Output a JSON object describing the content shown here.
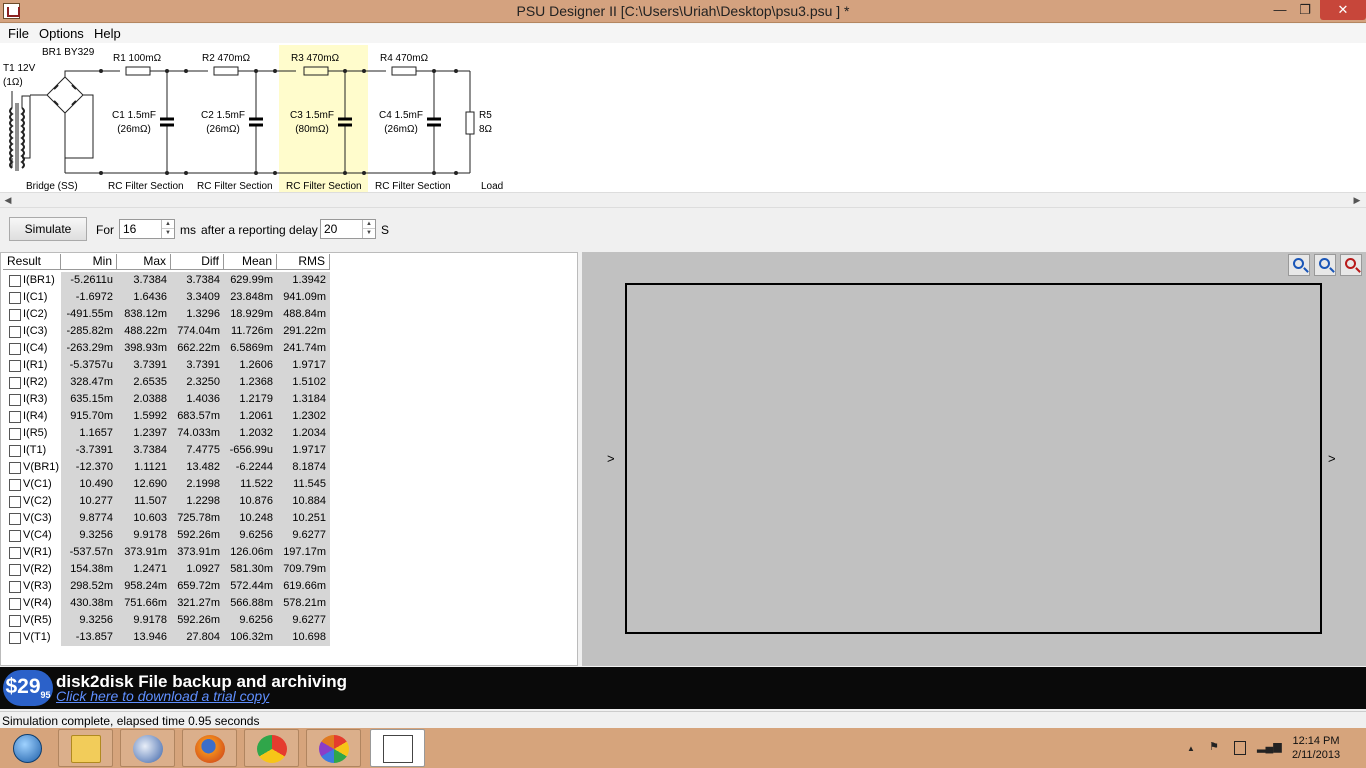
{
  "window": {
    "title": "PSU Designer II  [C:\\Users\\Uriah\\Desktop\\psu3.psu ] *",
    "min_glyph": "—",
    "max_glyph": "❐",
    "close_glyph": "✕"
  },
  "menu": {
    "file": "File",
    "options": "Options",
    "help": "Help"
  },
  "schematic": {
    "t1_name": "T1 12V",
    "t1_res": "(1Ω)",
    "br1": "BR1 BY329",
    "r1": "R1 100mΩ",
    "r2": "R2 470mΩ",
    "r3": "R3 470mΩ",
    "r4": "R4 470mΩ",
    "c1_val": "C1 1.5mF",
    "c1_esr": "(26mΩ)",
    "c2_val": "C2 1.5mF",
    "c2_esr": "(26mΩ)",
    "c3_val": "C3 1.5mF",
    "c3_esr": "(80mΩ)",
    "c4_val": "C4 1.5mF",
    "c4_esr": "(26mΩ)",
    "r5_name": "R5",
    "r5_val": "8Ω",
    "bridge_label": "Bridge (SS)",
    "section1": "RC Filter Section",
    "section2": "RC Filter Section",
    "section3": "RC Filter Section",
    "section4": "RC Filter Section",
    "load_label": "Load"
  },
  "toolbar": {
    "simulate": "Simulate",
    "for_label": "For",
    "duration": "16",
    "ms_label": "ms",
    "delay_label": "after a reporting delay of",
    "delay": "20",
    "s_label": "S"
  },
  "results": {
    "headers": [
      "Result",
      "Min",
      "Max",
      "Diff",
      "Mean",
      "RMS"
    ],
    "rows": [
      {
        "name": "I(BR1)",
        "min": "-5.2611u",
        "max": "3.7384",
        "diff": "3.7384",
        "mean": "629.99m",
        "rms": "1.3942"
      },
      {
        "name": "I(C1)",
        "min": "-1.6972",
        "max": "1.6436",
        "diff": "3.3409",
        "mean": "23.848m",
        "rms": "941.09m"
      },
      {
        "name": "I(C2)",
        "min": "-491.55m",
        "max": "838.12m",
        "diff": "1.3296",
        "mean": "18.929m",
        "rms": "488.84m"
      },
      {
        "name": "I(C3)",
        "min": "-285.82m",
        "max": "488.22m",
        "diff": "774.04m",
        "mean": "11.726m",
        "rms": "291.22m"
      },
      {
        "name": "I(C4)",
        "min": "-263.29m",
        "max": "398.93m",
        "diff": "662.22m",
        "mean": "6.5869m",
        "rms": "241.74m"
      },
      {
        "name": "I(R1)",
        "min": "-5.3757u",
        "max": "3.7391",
        "diff": "3.7391",
        "mean": "1.2606",
        "rms": "1.9717"
      },
      {
        "name": "I(R2)",
        "min": "328.47m",
        "max": "2.6535",
        "diff": "2.3250",
        "mean": "1.2368",
        "rms": "1.5102"
      },
      {
        "name": "I(R3)",
        "min": "635.15m",
        "max": "2.0388",
        "diff": "1.4036",
        "mean": "1.2179",
        "rms": "1.3184"
      },
      {
        "name": "I(R4)",
        "min": "915.70m",
        "max": "1.5992",
        "diff": "683.57m",
        "mean": "1.2061",
        "rms": "1.2302"
      },
      {
        "name": "I(R5)",
        "min": "1.1657",
        "max": "1.2397",
        "diff": "74.033m",
        "mean": "1.2032",
        "rms": "1.2034"
      },
      {
        "name": "I(T1)",
        "min": "-3.7391",
        "max": "3.7384",
        "diff": "7.4775",
        "mean": "-656.99u",
        "rms": "1.9717"
      },
      {
        "name": "V(BR1)",
        "min": "-12.370",
        "max": "1.1121",
        "diff": "13.482",
        "mean": "-6.2244",
        "rms": "8.1874"
      },
      {
        "name": "V(C1)",
        "min": "10.490",
        "max": "12.690",
        "diff": "2.1998",
        "mean": "11.522",
        "rms": "11.545"
      },
      {
        "name": "V(C2)",
        "min": "10.277",
        "max": "11.507",
        "diff": "1.2298",
        "mean": "10.876",
        "rms": "10.884"
      },
      {
        "name": "V(C3)",
        "min": "9.8774",
        "max": "10.603",
        "diff": "725.78m",
        "mean": "10.248",
        "rms": "10.251"
      },
      {
        "name": "V(C4)",
        "min": "9.3256",
        "max": "9.9178",
        "diff": "592.26m",
        "mean": "9.6256",
        "rms": "9.6277"
      },
      {
        "name": "V(R1)",
        "min": "-537.57n",
        "max": "373.91m",
        "diff": "373.91m",
        "mean": "126.06m",
        "rms": "197.17m"
      },
      {
        "name": "V(R2)",
        "min": "154.38m",
        "max": "1.2471",
        "diff": "1.0927",
        "mean": "581.30m",
        "rms": "709.79m"
      },
      {
        "name": "V(R3)",
        "min": "298.52m",
        "max": "958.24m",
        "diff": "659.72m",
        "mean": "572.44m",
        "rms": "619.66m"
      },
      {
        "name": "V(R4)",
        "min": "430.38m",
        "max": "751.66m",
        "diff": "321.27m",
        "mean": "566.88m",
        "rms": "578.21m"
      },
      {
        "name": "V(R5)",
        "min": "9.3256",
        "max": "9.9178",
        "diff": "592.26m",
        "mean": "9.6256",
        "rms": "9.6277"
      },
      {
        "name": "V(T1)",
        "min": "-13.857",
        "max": "13.946",
        "diff": "27.804",
        "mean": "106.32m",
        "rms": "10.698"
      }
    ]
  },
  "graph": {
    "left_arrow": ">",
    "right_arrow": ">"
  },
  "ad": {
    "price": "$29",
    "price_cents": "95",
    "headline": "disk2disk File backup and archiving",
    "link": "Click here to download a trial copy"
  },
  "status": "Simulation complete, elapsed time 0.95 seconds",
  "taskbar": {
    "time": "12:14 PM",
    "date": "2/11/2013",
    "tray_chevron": "▲"
  },
  "colors": {
    "titlebar": "#d4a27f",
    "highlight": "#fffccc",
    "ad_background": "#0a0a0a",
    "price_badge": "#2b61c9",
    "link": "#5f8fff",
    "graph_background": "#c1c1c1"
  }
}
